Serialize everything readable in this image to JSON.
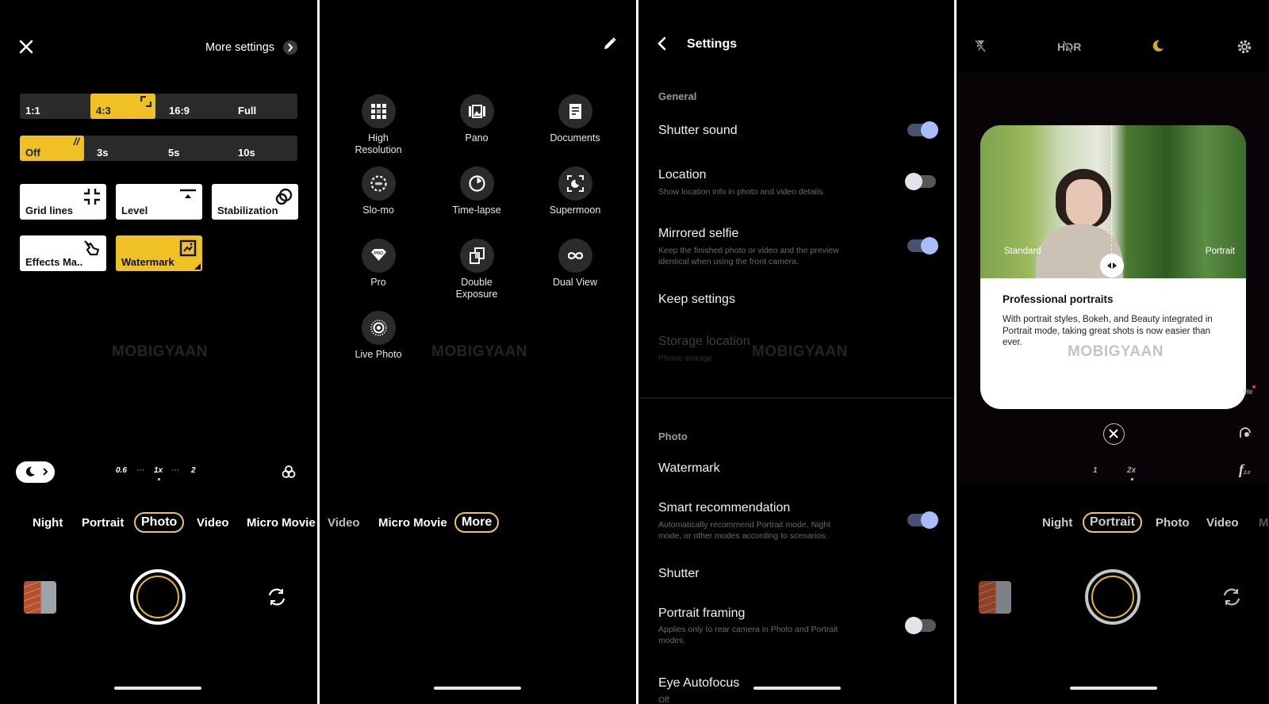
{
  "watermark": "MOBIGYAAN",
  "panel1": {
    "close_icon": "close-icon",
    "more_settings_label": "More settings",
    "aspect_ratios": [
      {
        "label": "1:1",
        "active": false
      },
      {
        "label": "4:3",
        "active": true
      },
      {
        "label": "16:9",
        "active": false
      },
      {
        "label": "Full",
        "active": false
      }
    ],
    "timers": [
      {
        "label": "Off",
        "active": true
      },
      {
        "label": "3s",
        "active": false
      },
      {
        "label": "5s",
        "active": false
      },
      {
        "label": "10s",
        "active": false
      }
    ],
    "tiles": [
      {
        "label": "Grid lines",
        "icon": "grid-lines-icon",
        "active": false
      },
      {
        "label": "Level",
        "icon": "level-icon",
        "active": false
      },
      {
        "label": "Stabilization",
        "icon": "stabilization-icon",
        "active": false
      },
      {
        "label": "Effects Ma..",
        "icon": "effects-icon",
        "active": false
      },
      {
        "label": "Watermark",
        "icon": "watermark-icon",
        "active": true
      }
    ],
    "zoom_levels": [
      "0.6",
      "1x",
      "2"
    ],
    "zoom_selected": "1x",
    "modes": [
      "Night",
      "Portrait",
      "Photo",
      "Video",
      "Micro Movie"
    ],
    "active_mode": "Photo"
  },
  "panel2": {
    "edit_icon": "pencil-icon",
    "more_modes": [
      {
        "label": "High\nResolution",
        "icon": "high-resolution-icon"
      },
      {
        "label": "Pano",
        "icon": "pano-icon"
      },
      {
        "label": "Documents",
        "icon": "documents-icon"
      },
      {
        "label": "Slo-mo",
        "icon": "slo-mo-icon"
      },
      {
        "label": "Time-lapse",
        "icon": "time-lapse-icon"
      },
      {
        "label": "Supermoon",
        "icon": "supermoon-icon"
      },
      {
        "label": "Pro",
        "icon": "pro-icon"
      },
      {
        "label": "Double\nExposure",
        "icon": "double-exposure-icon"
      },
      {
        "label": "Dual View",
        "icon": "dual-view-icon"
      },
      {
        "label": "Live Photo",
        "icon": "live-photo-icon"
      }
    ],
    "modes": [
      "Video",
      "Micro Movie",
      "More"
    ],
    "active_mode": "More"
  },
  "panel3": {
    "title": "Settings",
    "sections": [
      {
        "header": "General",
        "items": [
          {
            "title": "Shutter sound",
            "subtitle": "",
            "toggle": true
          },
          {
            "title": "Location",
            "subtitle": "Show location info in photo and video details.",
            "toggle": false
          },
          {
            "title": "Mirrored selfie",
            "subtitle": "Keep the finished photo or video and the preview identical when using the front camera.",
            "toggle": true
          },
          {
            "title": "Keep settings",
            "subtitle": "",
            "toggle": null
          },
          {
            "title": "Storage location",
            "subtitle": "Phone storage",
            "toggle": null,
            "disabled": true
          }
        ]
      },
      {
        "header": "Photo",
        "items": [
          {
            "title": "Watermark",
            "subtitle": "",
            "toggle": null
          },
          {
            "title": "Smart recommendation",
            "subtitle": "Automatically recommend Portrait mode, Night mode, or other modes according to scenarios.",
            "toggle": true
          },
          {
            "title": "Shutter",
            "subtitle": "",
            "toggle": null
          },
          {
            "title": "Portrait framing",
            "subtitle": "Applies only to rear camera in Photo and Portrait modes.",
            "toggle": false
          },
          {
            "title": "Eye Autofocus",
            "subtitle": "Off",
            "toggle": null
          }
        ]
      }
    ],
    "toggle_on_color": "#a8bdf7"
  },
  "panel4": {
    "top_icons": [
      "flash-off-icon",
      "hdr-off-icon",
      "night-moon-icon",
      "settings-gear-icon"
    ],
    "hdr_label": "HDR",
    "card": {
      "left_label": "Standard",
      "right_label": "Portrait",
      "title": "Professional portraits",
      "body": "With portrait styles, Bokeh, and Beauty integrated in Portrait mode, taking great shots is now easier than ever."
    },
    "side_label": "yle",
    "zoom_levels": [
      "1",
      "2x"
    ],
    "zoom_selected": "2x",
    "aperture_label": "f",
    "aperture_value": "2.0",
    "modes": [
      "Night",
      "Portrait",
      "Photo",
      "Video",
      "M"
    ],
    "active_mode": "Portrait"
  },
  "colors": {
    "accent_yellow": "#efc125",
    "mode_pill_border": "#e8c46a",
    "toggle_track_on": "#4a5170"
  }
}
